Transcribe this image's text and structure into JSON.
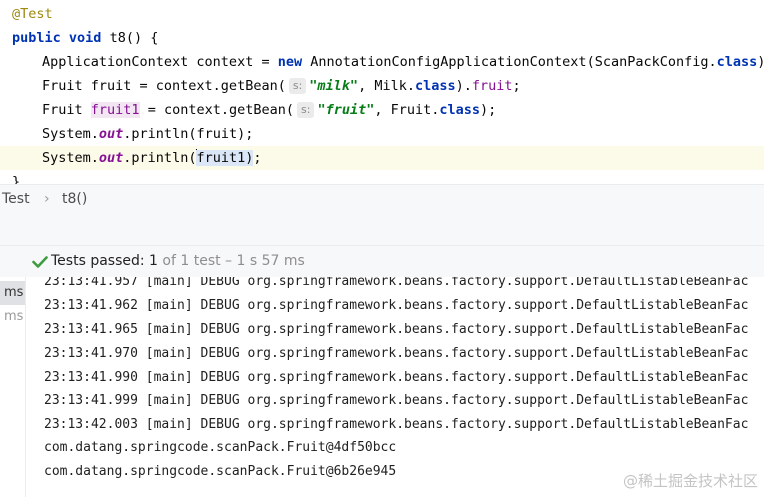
{
  "editor": {
    "annotation": "@Test",
    "method_kw": "public",
    "void_kw": "void",
    "method_sig": " t8() {",
    "line3": {
      "type": "ApplicationContext context = ",
      "new_kw": "new",
      "ctor": " AnnotationConfigApplicationContext(ScanPackConfig.",
      "class_kw": "class",
      "end": ");"
    },
    "line4": {
      "pre": "Fruit fruit = context.getBean(",
      "hint": "s:",
      "str": "\"milk\"",
      "mid": ", Milk.",
      "class_kw": "class",
      "mid2": ").",
      "field": "fruit",
      "end": ";"
    },
    "line5": {
      "pre": "Fruit ",
      "var": "fruit1",
      "mid": " = context.getBean(",
      "hint": "s:",
      "str": "\"fruit\"",
      "mid2": ", Fruit.",
      "class_kw": "class",
      "end": ");"
    },
    "line6": {
      "pre": "System.",
      "sfield": "out",
      "post": ".println(fruit);"
    },
    "line7": {
      "pre": "System.",
      "sfield": "out",
      "mid": ".println(",
      "arg": "fruit1",
      "close": ")",
      "end": ";"
    },
    "line8": "}"
  },
  "breadcrumb": {
    "class_name": "Test",
    "separator": "›",
    "method": "t8()"
  },
  "status": {
    "passed_label": "Tests passed: ",
    "passed_count": "1",
    "rest": " of 1 test – 1 s 57 ms",
    "check_color": "#3f9b3f"
  },
  "left_pane": {
    "items": [
      "ms",
      "ms"
    ]
  },
  "console": {
    "lines": [
      "23:13:41.957 [main] DEBUG org.springframework.beans.factory.support.DefaultListableBeanFac",
      "23:13:41.962 [main] DEBUG org.springframework.beans.factory.support.DefaultListableBeanFac",
      "23:13:41.965 [main] DEBUG org.springframework.beans.factory.support.DefaultListableBeanFac",
      "23:13:41.970 [main] DEBUG org.springframework.beans.factory.support.DefaultListableBeanFac",
      "23:13:41.990 [main] DEBUG org.springframework.beans.factory.support.DefaultListableBeanFac",
      "23:13:41.999 [main] DEBUG org.springframework.beans.factory.support.DefaultListableBeanFac",
      "23:13:42.003 [main] DEBUG org.springframework.beans.factory.support.DefaultListableBeanFac",
      "com.datang.springcode.scanPack.Fruit@4df50bcc",
      "com.datang.springcode.scanPack.Fruit@6b26e945"
    ]
  },
  "watermark": "@稀土掘金技术社区"
}
